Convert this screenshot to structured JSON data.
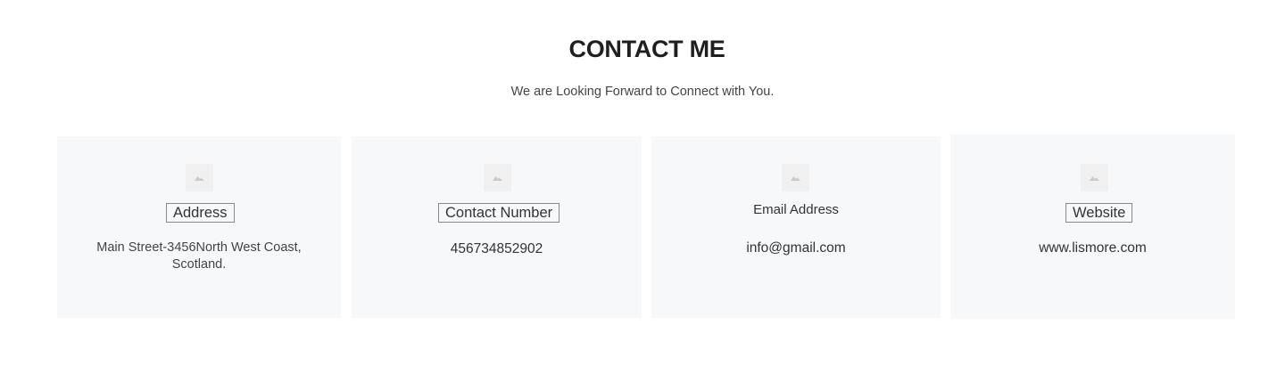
{
  "section": {
    "title": "CONTACT ME",
    "subtitle": "We are Looking Forward to Connect with You."
  },
  "cards": [
    {
      "icon": "image-placeholder-icon",
      "title": "Address",
      "text": "Main Street-3456North West Coast, Scotland."
    },
    {
      "icon": "image-placeholder-icon",
      "title": "Contact Number",
      "text": "456734852902"
    },
    {
      "icon": "image-placeholder-icon",
      "title": "Email Address",
      "text": "info@gmail.com"
    },
    {
      "icon": "image-placeholder-icon",
      "title": "Website",
      "text": "www.lismore.com"
    }
  ],
  "colors": {
    "card_background": "#f7f8fa",
    "icon_background": "#f0f0f1",
    "title_color": "#1f1f1f",
    "text_color": "#444444"
  }
}
